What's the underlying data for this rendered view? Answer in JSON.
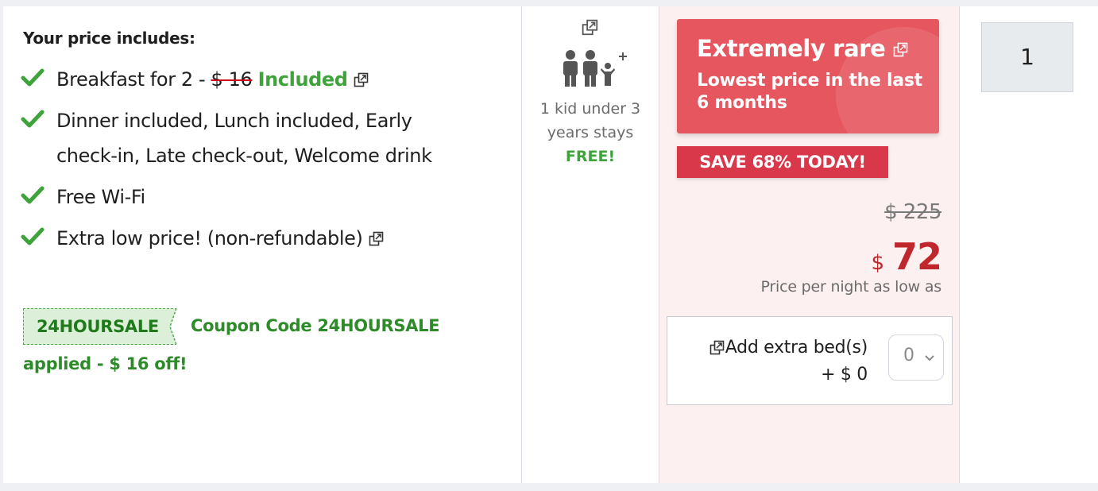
{
  "includes": {
    "title": "Your price includes:",
    "breakfast": {
      "prefix": "Breakfast for 2 -",
      "old_price": "$ 16",
      "status": "Included"
    },
    "meals": "Dinner included, Lunch included, Early check-in, Late check-out, Welcome drink",
    "wifi": "Free Wi-Fi",
    "refund": "Extra low price! (non-refundable)",
    "coupon": {
      "code": "24HOURSALE",
      "text": "Coupon Code 24HOURSALE applied - $ 16 off!"
    }
  },
  "occupancy": {
    "line1": "1 kid under 3",
    "line2": "years stays",
    "free": "FREE!"
  },
  "price": {
    "rare_title": "Extremely rare",
    "rare_sub": "Lowest price in the last 6 months",
    "save": "SAVE 68% TODAY!",
    "old": "$ 225",
    "currency": "$",
    "amount": "72",
    "note": "Price per night as low as",
    "bed_line1": "Add extra bed(s)",
    "bed_line2": "+ $ 0",
    "bed_value": "0"
  },
  "quantity": {
    "value": "1"
  },
  "colors": {
    "green": "#3ea33a",
    "red": "#c0272d",
    "rare": "#e6565f"
  }
}
